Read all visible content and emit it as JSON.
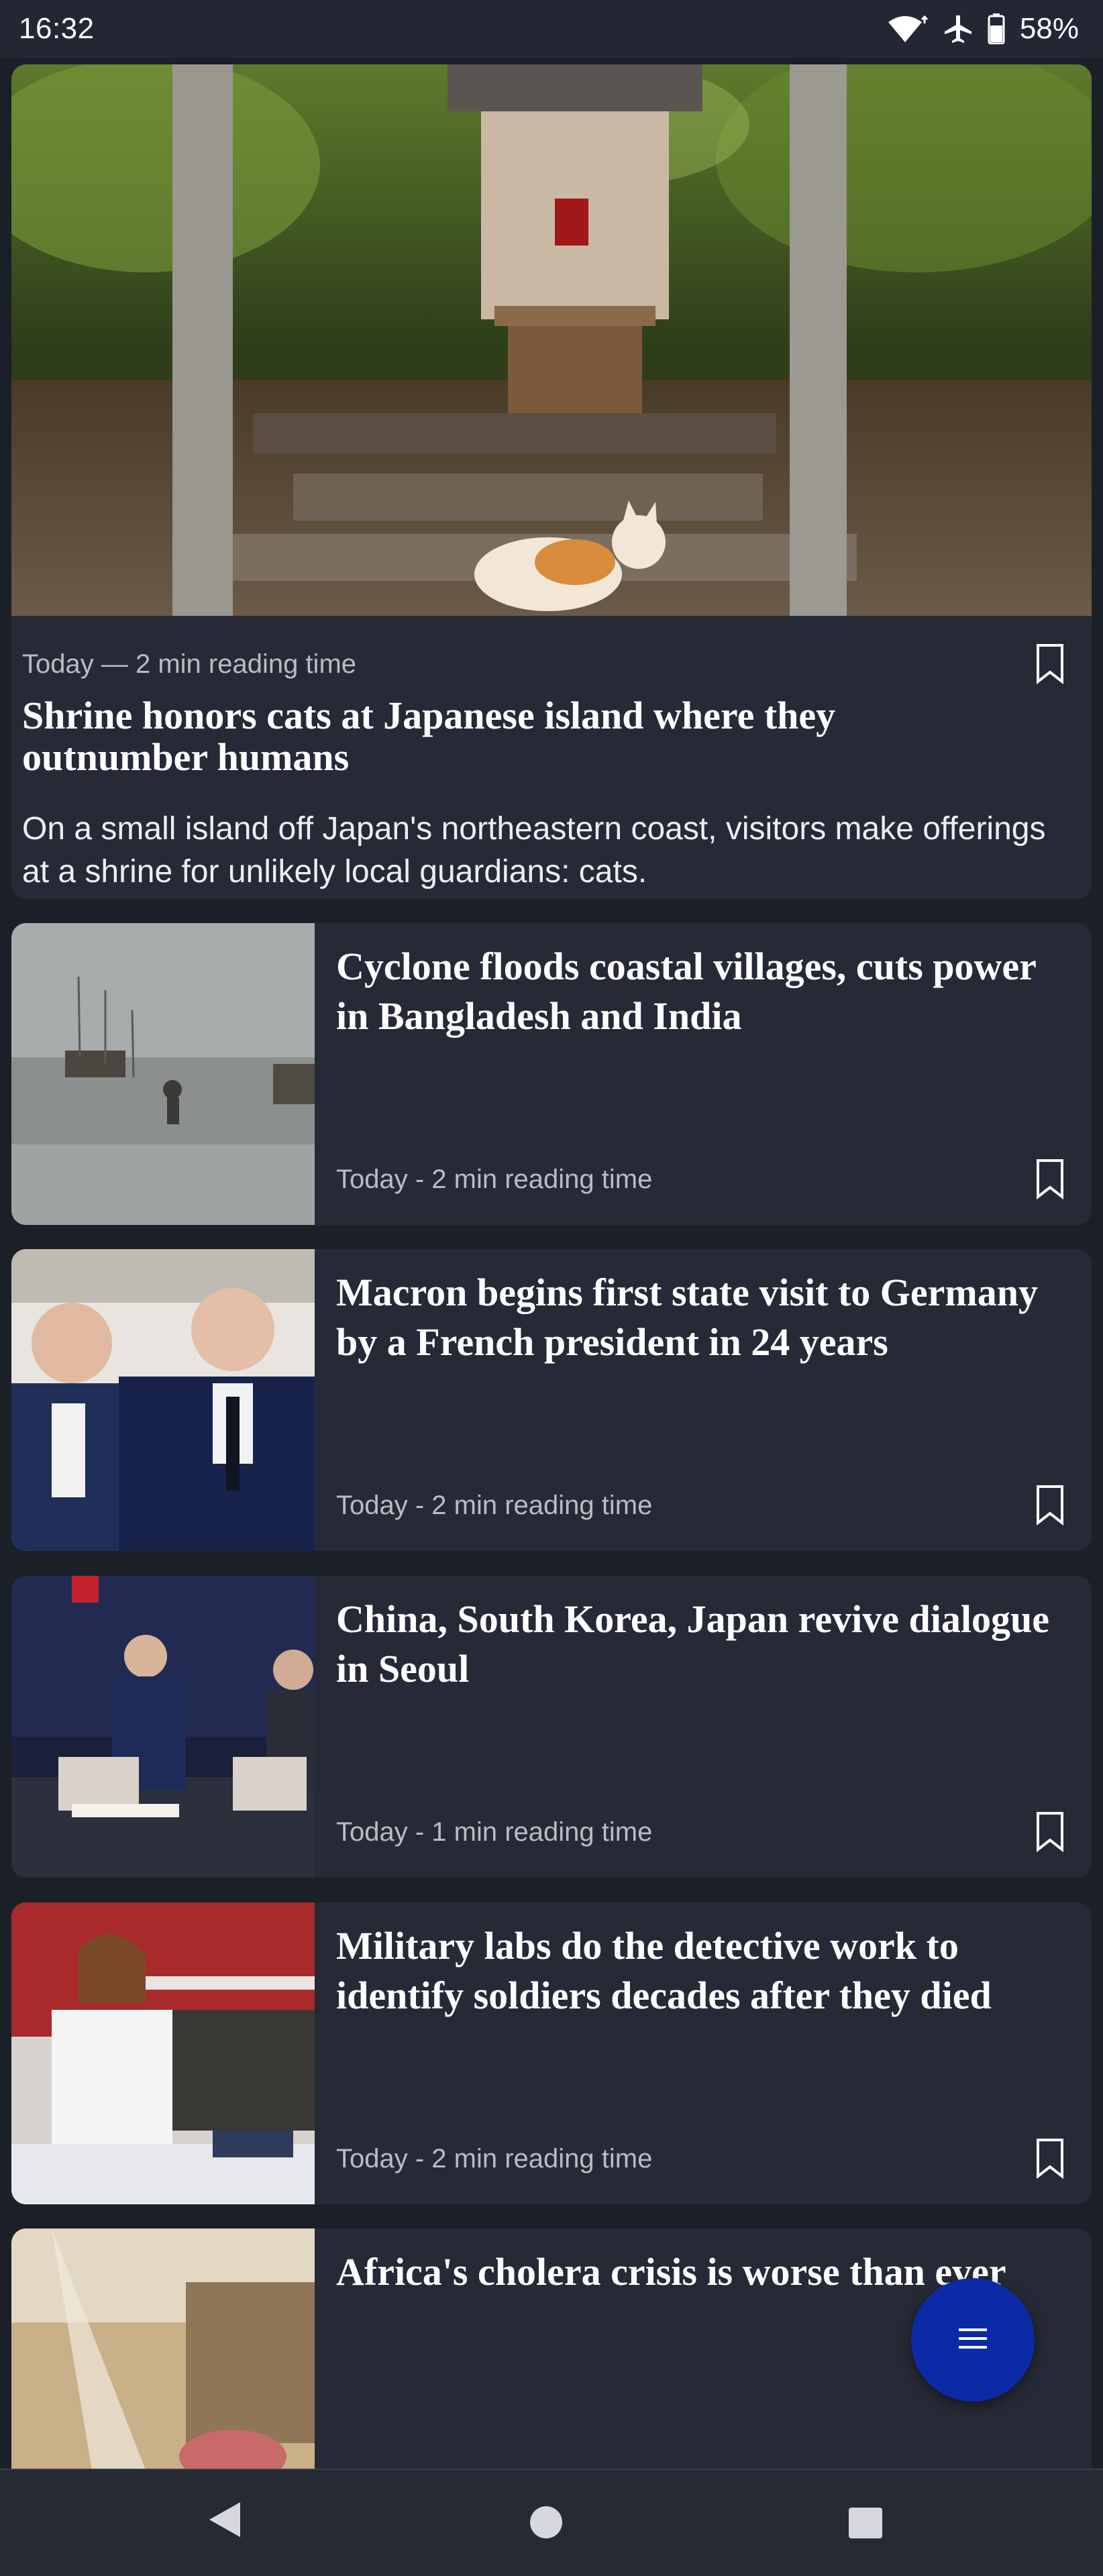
{
  "status_bar": {
    "time": "16:32",
    "battery": "58%",
    "icons": [
      "wifi-icon",
      "airplane-mode-icon",
      "battery-icon"
    ]
  },
  "hero": {
    "meta": "Today — 2 min reading time",
    "title": "Shrine honors cats at Japanese island where they outnumber humans",
    "summary": "On a small island off Japan's northeastern coast, visitors make offerings at a shrine for unlikely local guardians: cats.",
    "image": "shrine-with-cat-photo"
  },
  "articles": [
    {
      "title": "Cyclone floods coastal villages, cuts power in Bangladesh and India",
      "meta": "Today - 2 min reading time",
      "image": "flooded-coast-photo"
    },
    {
      "title": "Macron begins first state visit to Germany by a French president in 24 years",
      "meta": "Today - 2 min reading time",
      "image": "macron-steinmeier-photo"
    },
    {
      "title": "China, South Korea, Japan revive dialogue in Seoul",
      "meta": "Today - 1 min reading time",
      "image": "summit-stage-photo"
    },
    {
      "title": "Military labs do the detective work to identify soldiers decades after they died",
      "meta": "Today - 2 min reading time",
      "image": "lab-scientist-photo"
    },
    {
      "title": "Africa's cholera crisis is worse than ever",
      "meta": "",
      "image": "cholera-ward-photo"
    }
  ],
  "colors": {
    "background": "#1b1f28",
    "card": "#262a36",
    "fab": "#0c2aa6",
    "meta_text": "#b9bcc4"
  }
}
